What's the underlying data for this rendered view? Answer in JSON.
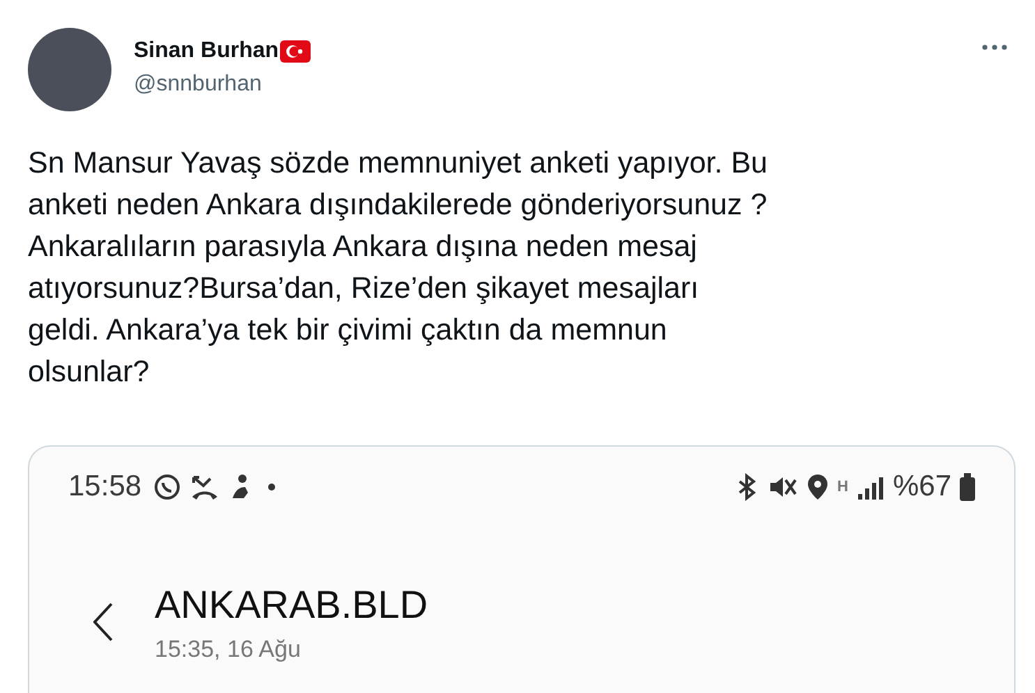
{
  "author": {
    "name": "Sinan Burhan",
    "handle": "@snnburhan"
  },
  "tweet": {
    "text": "Sn Mansur Yavaş sözde memnuniyet anketi yapıyor. Bu\nanketi neden Ankara dışındakilerede gönderiyorsunuz ?\nAnkaralıların parasıyla Ankara dışına neden mesaj\natıyorsunuz?Bursa’dan, Rize’den şikayet mesajları\ngeldi. Ankara’ya tek bir çivimi çaktın da memnun\nolsunlar?"
  },
  "screenshot": {
    "status_bar": {
      "time": "15:58",
      "network_label": "H",
      "battery": "%67"
    },
    "sender": "ANKARAB.BLD",
    "date": "15:35, 16 Ağu"
  }
}
